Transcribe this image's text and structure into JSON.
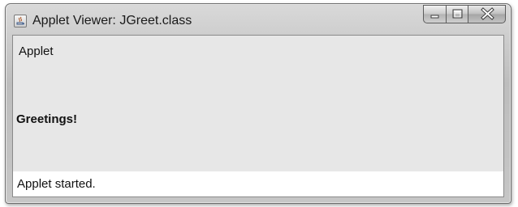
{
  "window": {
    "title": "Applet Viewer: JGreet.class",
    "icon": "java-applet-icon",
    "controls": [
      "minimize-icon",
      "maximize-icon",
      "close-icon"
    ]
  },
  "applet_menu": {
    "label": "Applet"
  },
  "applet_content": {
    "greeting": "Greetings!"
  },
  "status_bar": {
    "text": "Applet started."
  }
}
